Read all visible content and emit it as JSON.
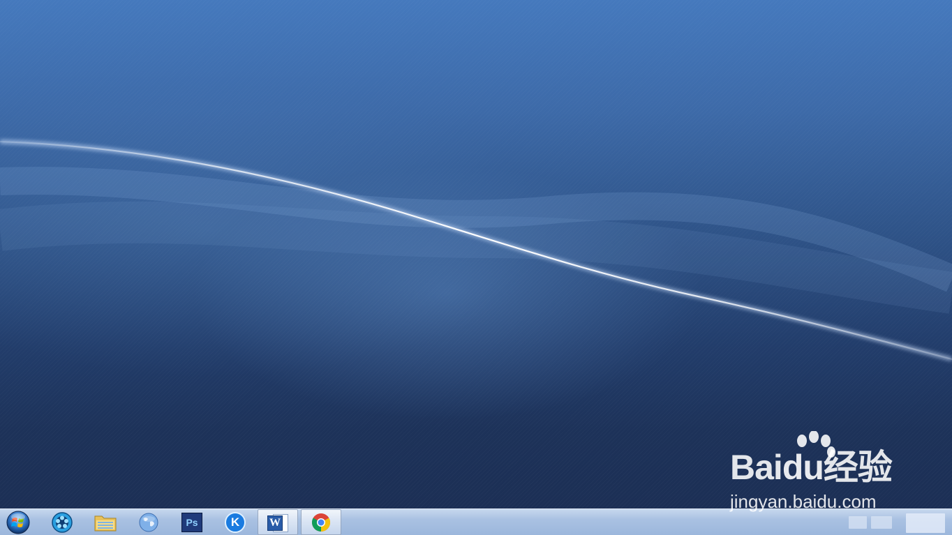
{
  "watermark": {
    "logo_prefix": "Bai",
    "logo_du": "du",
    "logo_suffix": "经验",
    "url": "jingyan.baidu.com"
  },
  "taskbar": {
    "start_icon": "windows-orb-icon",
    "pinned": [
      {
        "name": "media-player",
        "icon": "media-player-icon",
        "active": false
      },
      {
        "name": "file-explorer",
        "icon": "folder-icon",
        "active": false
      },
      {
        "name": "browser-globe",
        "icon": "globe-icon",
        "active": false
      },
      {
        "name": "photoshop",
        "icon": "photoshop-icon",
        "label": "Ps",
        "active": false
      },
      {
        "name": "kugou",
        "icon": "kugou-icon",
        "label": "K",
        "active": false
      },
      {
        "name": "word",
        "icon": "word-icon",
        "label": "W",
        "active": true
      },
      {
        "name": "chrome",
        "icon": "chrome-icon",
        "active": true
      }
    ]
  },
  "colors": {
    "wallpaper_top": "#4579bd",
    "wallpaper_bottom": "#1c2f55",
    "taskbar": "#a9c1e2",
    "photoshop": "#1f3a7a",
    "kugou": "#1a7be0",
    "word": "#2a5ca8"
  }
}
